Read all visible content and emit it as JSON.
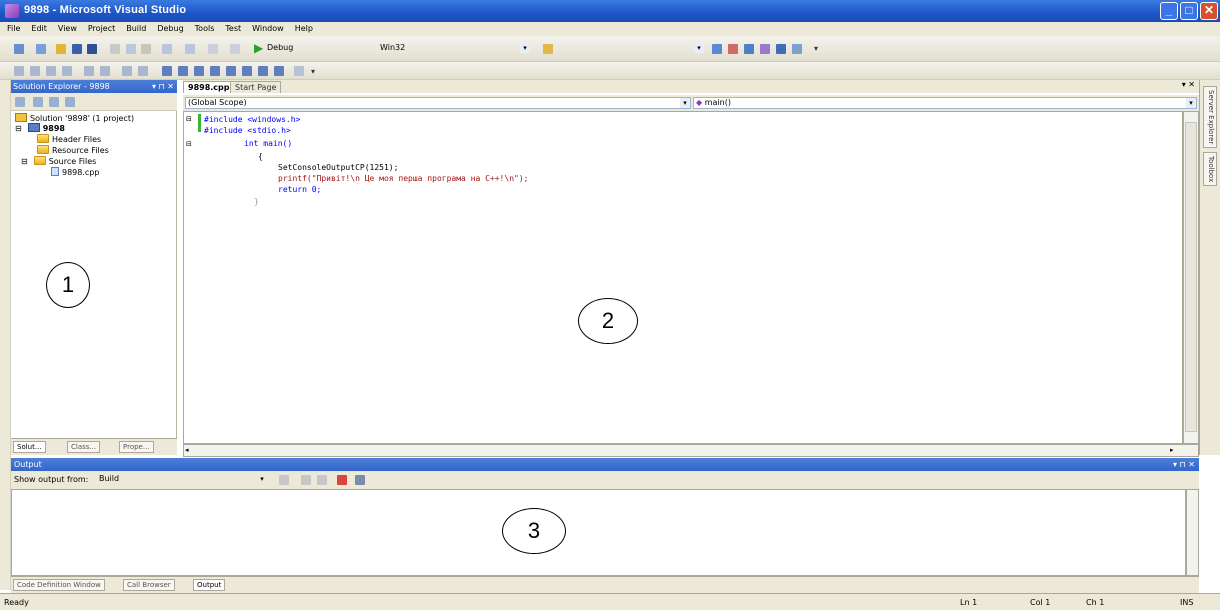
{
  "window": {
    "title": "9898 - Microsoft Visual Studio"
  },
  "menu": [
    "File",
    "Edit",
    "View",
    "Project",
    "Build",
    "Debug",
    "Tools",
    "Test",
    "Window",
    "Help"
  ],
  "toolbar": {
    "config": "Debug",
    "platform": "Win32"
  },
  "solution_explorer": {
    "title": "Solution Explorer - 9898",
    "tree": [
      {
        "label": "Solution '9898' (1 project)",
        "icon": "solution-icon"
      },
      {
        "label": "9898",
        "icon": "project-icon"
      },
      {
        "label": "Header Files",
        "icon": "folder-icon"
      },
      {
        "label": "Resource Files",
        "icon": "folder-icon"
      },
      {
        "label": "Source Files",
        "icon": "folder-icon"
      },
      {
        "label": "9898.cpp",
        "icon": "cpp-file-icon"
      }
    ],
    "tabs": [
      "Solut...",
      "Class...",
      "Prope..."
    ]
  },
  "editor": {
    "tabs": [
      "9898.cpp",
      "Start Page"
    ],
    "scope": "(Global Scope)",
    "member": "main()",
    "code": [
      "#include <windows.h>",
      "#include <stdio.h>",
      "int main()",
      "{",
      "SetConsoleOutputCP(1251);",
      "printf(\"Привіт!\\n Це моя перша програма на C++!\\n\");",
      "return 0;",
      "}"
    ]
  },
  "right_strip": [
    "Server Explorer",
    "Toolbox"
  ],
  "output": {
    "title": "Output",
    "show_output_label": "Show output from:",
    "show_output_value": "Build",
    "tabs": [
      "Code Definition Window",
      "Call Browser",
      "Output"
    ]
  },
  "status": {
    "ready": "Ready",
    "ln": "Ln 1",
    "col": "Col 1",
    "ch": "Ch 1",
    "mode": "INS"
  },
  "annotations": [
    "1",
    "2",
    "3"
  ]
}
